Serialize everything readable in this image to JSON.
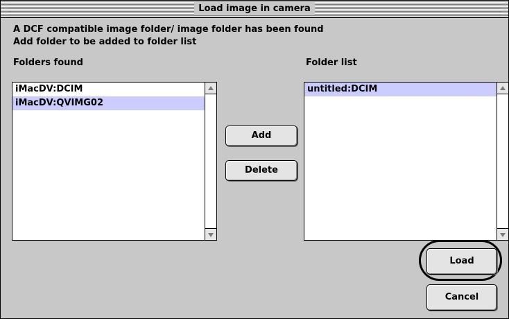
{
  "dialog": {
    "title": "Load image in camera",
    "message_line1": "A DCF compatible image folder/ image folder has been found",
    "message_line2": "Add folder to be added to folder list"
  },
  "folders_found": {
    "label": "Folders found",
    "items": [
      "iMacDV:DCIM",
      "iMacDV:QVIMG02"
    ],
    "selected_index": 1
  },
  "folder_list": {
    "label": "Folder list",
    "items": [
      "untitled:DCIM"
    ],
    "selected_index": 0
  },
  "buttons": {
    "add": "Add",
    "delete": "Delete",
    "load": "Load",
    "cancel": "Cancel"
  },
  "icons": {
    "scroll_up": "scroll-up-arrow-icon",
    "scroll_down": "scroll-down-arrow-icon"
  },
  "colors": {
    "dialog_bg": "#c8c8c8",
    "selection": "#ccccff"
  }
}
